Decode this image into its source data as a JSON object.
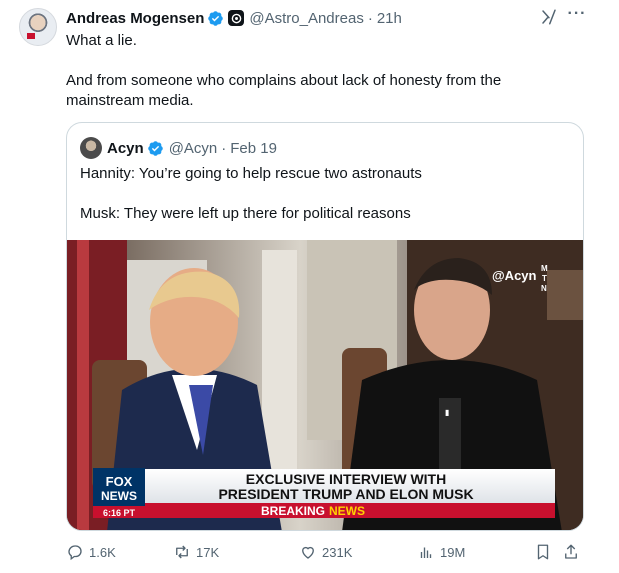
{
  "post": {
    "author_name": "Andreas Mogensen",
    "author_handle": "@Astro_Andreas",
    "time": "21h",
    "line1": "What a lie.",
    "line2": "And from someone who complains about lack of honesty from the mainstream media."
  },
  "quoted": {
    "author_name": "Acyn",
    "author_handle": "@Acyn",
    "date": "Feb 19",
    "line1": "Hannity: You’re going to help rescue two astronauts",
    "line2": "Musk: They were left up there for political reasons",
    "video": {
      "watermark": "@Acyn",
      "watermark_logo": "MTN",
      "network_logo": "FOX NEWS",
      "clock": "6:16 PT",
      "chyron_line1": "EXCLUSIVE INTERVIEW WITH",
      "chyron_line2": "PRESIDENT TRUMP AND ELON MUSK",
      "breaking_1": "BREAKING",
      "breaking_2": "NEWS"
    }
  },
  "actions": {
    "replies": "1.6K",
    "reposts": "17K",
    "likes": "231K",
    "views": "19M"
  },
  "colors": {
    "verified": "#1d9bf0",
    "muted_text": "#536471",
    "chyron_red": "#c8102e",
    "fox_blue": "#003366"
  },
  "icons": [
    "verified-icon",
    "org-badge-icon",
    "grok-icon",
    "more-icon",
    "reply-icon",
    "repost-icon",
    "like-icon",
    "views-icon",
    "bookmark-icon",
    "share-icon"
  ]
}
